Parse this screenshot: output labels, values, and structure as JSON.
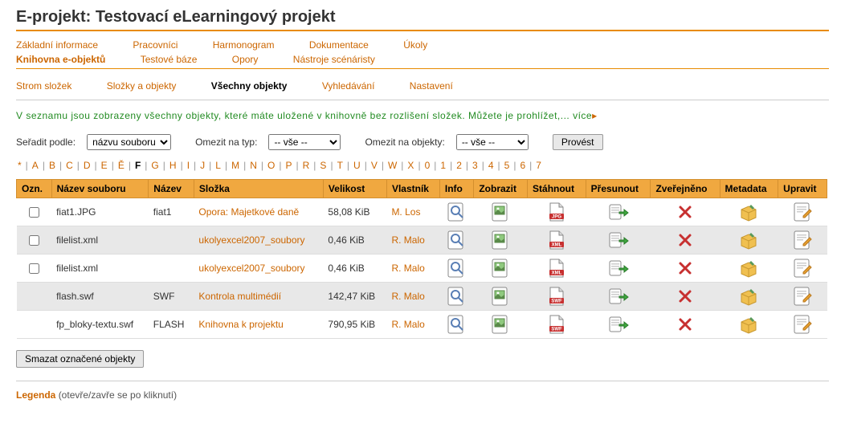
{
  "title": "E-projekt: Testovací eLearningový projekt",
  "nav1": [
    "Základní informace",
    "Pracovníci",
    "Harmonogram",
    "Dokumentace",
    "Úkoly"
  ],
  "nav2": [
    "Knihovna e-objektů",
    "Testové báze",
    "Opory",
    "Nástroje scénáristy"
  ],
  "nav2_active": 0,
  "subnav": [
    "Strom složek",
    "Složky a objekty",
    "Všechny objekty",
    "Vyhledávání",
    "Nastavení"
  ],
  "subnav_active": 2,
  "info_text": "V  seznamu  jsou  zobrazeny  všechny  objekty,  které  máte  uložené  v  knihovně  bez  rozlišení  složek.  Můžete  je prohlížet,",
  "info_more": "... více",
  "sort_label": "Seřadit podle:",
  "sort_value": "názvu souboru",
  "limit_type_label": "Omezit na typ:",
  "limit_type_value": "-- vše --",
  "limit_obj_label": "Omezit na objekty:",
  "limit_obj_value": "-- vše --",
  "submit_btn": "Provést",
  "alpha": [
    "*",
    "A",
    "B",
    "C",
    "D",
    "E",
    "Ě",
    "F",
    "G",
    "H",
    "I",
    "J",
    "L",
    "M",
    "N",
    "O",
    "P",
    "R",
    "S",
    "T",
    "U",
    "V",
    "W",
    "X",
    "0",
    "1",
    "2",
    "3",
    "4",
    "5",
    "6",
    "7"
  ],
  "alpha_active": "F",
  "columns": [
    "Ozn.",
    "Název souboru",
    "Název",
    "Složka",
    "Velikost",
    "Vlastník",
    "Info",
    "Zobrazit",
    "Stáhnout",
    "Přesunout",
    "Zveřejněno",
    "Metadata",
    "Upravit"
  ],
  "rows": [
    {
      "check": true,
      "file": "fiat1.JPG",
      "name": "fiat1",
      "folder": "Opora: Majetkové daně",
      "size": "58,08 KiB",
      "owner": "M. Los",
      "dl": "JPG",
      "alt": false
    },
    {
      "check": true,
      "file": "filelist.xml",
      "name": "",
      "folder": "ukolyexcel2007_soubory",
      "size": "0,46 KiB",
      "owner": "R. Malo",
      "dl": "XML",
      "alt": true
    },
    {
      "check": true,
      "file": "filelist.xml",
      "name": "",
      "folder": "ukolyexcel2007_soubory",
      "size": "0,46 KiB",
      "owner": "R. Malo",
      "dl": "XML",
      "alt": false
    },
    {
      "check": false,
      "file": "flash.swf",
      "name": "SWF",
      "folder": "Kontrola multimédií",
      "size": "142,47 KiB",
      "owner": "R. Malo",
      "dl": "SWF",
      "alt": true
    },
    {
      "check": false,
      "file": "fp_bloky-textu.swf",
      "name": "FLASH",
      "folder": "Knihovna k projektu",
      "size": "790,95 KiB",
      "owner": "R. Malo",
      "dl": "SWF",
      "alt": false
    }
  ],
  "delete_btn": "Smazat označené objekty",
  "legend_title": "Legenda",
  "legend_text": "(otevře/zavře se po kliknutí)"
}
